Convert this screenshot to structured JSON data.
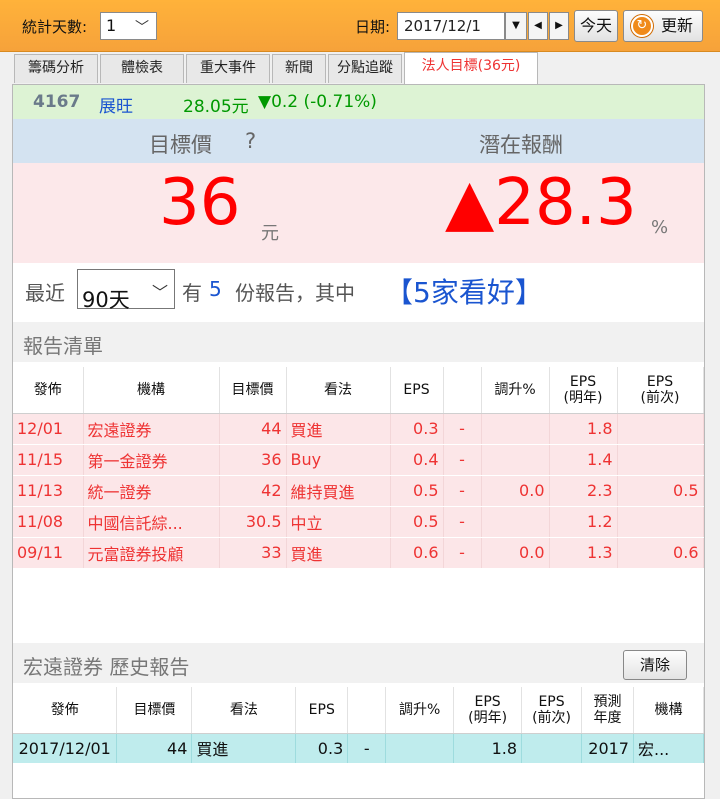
{
  "toolbar": {
    "days_label": "統計天數:",
    "days_value": "1",
    "date_label": "日期:",
    "date_value": "2017/12/1",
    "today_label": "今天",
    "refresh_label": "更新"
  },
  "tabs": [
    {
      "label": "籌碼分析",
      "active": false
    },
    {
      "label": "體檢表",
      "active": false
    },
    {
      "label": "重大事件",
      "active": false
    },
    {
      "label": "新聞",
      "active": false
    },
    {
      "label": "分點追蹤",
      "active": false
    },
    {
      "label": "法人目標(36元)",
      "active": true
    }
  ],
  "stock": {
    "code": "4167",
    "name": "展旺",
    "price": "28.05元",
    "change": "▼0.2 (-0.71%)"
  },
  "summary": {
    "target_label": "目標價",
    "help_mark": "?",
    "return_label": "潛在報酬",
    "target_value": "36",
    "target_unit": "元",
    "return_value": "▲28.3",
    "return_unit": "%"
  },
  "filter": {
    "prefix": "最近",
    "period": "90天",
    "has": "有",
    "count": "5",
    "suffix": "份報告，其中",
    "bullish": "【5家看好】"
  },
  "report_list": {
    "title": "報告清單",
    "columns": [
      "發佈",
      "機構",
      "目標價",
      "看法",
      "EPS",
      "",
      "調升%",
      "EPS\n(明年)",
      "EPS\n(前次)"
    ],
    "rows": [
      [
        "12/01",
        "宏遠證券",
        "44",
        "買進",
        "0.3",
        "-",
        "",
        "1.8",
        ""
      ],
      [
        "11/15",
        "第一金證券",
        "36",
        "Buy",
        "0.4",
        "-",
        "",
        "1.4",
        ""
      ],
      [
        "11/13",
        "統一證券",
        "42",
        "維持買進",
        "0.5",
        "-",
        "0.0",
        "2.3",
        "0.5"
      ],
      [
        "11/08",
        "中國信託綜...",
        "30.5",
        "中立",
        "0.5",
        "-",
        "",
        "1.2",
        ""
      ],
      [
        "09/11",
        "元富證券投顧",
        "33",
        "買進",
        "0.6",
        "-",
        "0.0",
        "1.3",
        "0.6"
      ]
    ]
  },
  "history": {
    "title": "宏遠證券 歷史報告",
    "clear_label": "清除",
    "columns": [
      "發佈",
      "目標價",
      "看法",
      "EPS",
      "",
      "調升%",
      "EPS\n(明年)",
      "EPS\n(前次)",
      "預測\n年度",
      "機構"
    ],
    "rows": [
      [
        "2017/12/01",
        "44",
        "買進",
        "0.3",
        "-",
        "",
        "1.8",
        "",
        "2017",
        "宏..."
      ]
    ]
  },
  "colors": {
    "toolbar": "#f6a23a",
    "up": "#ff0000",
    "down": "#009900",
    "accent_blue": "#1a55d0"
  }
}
